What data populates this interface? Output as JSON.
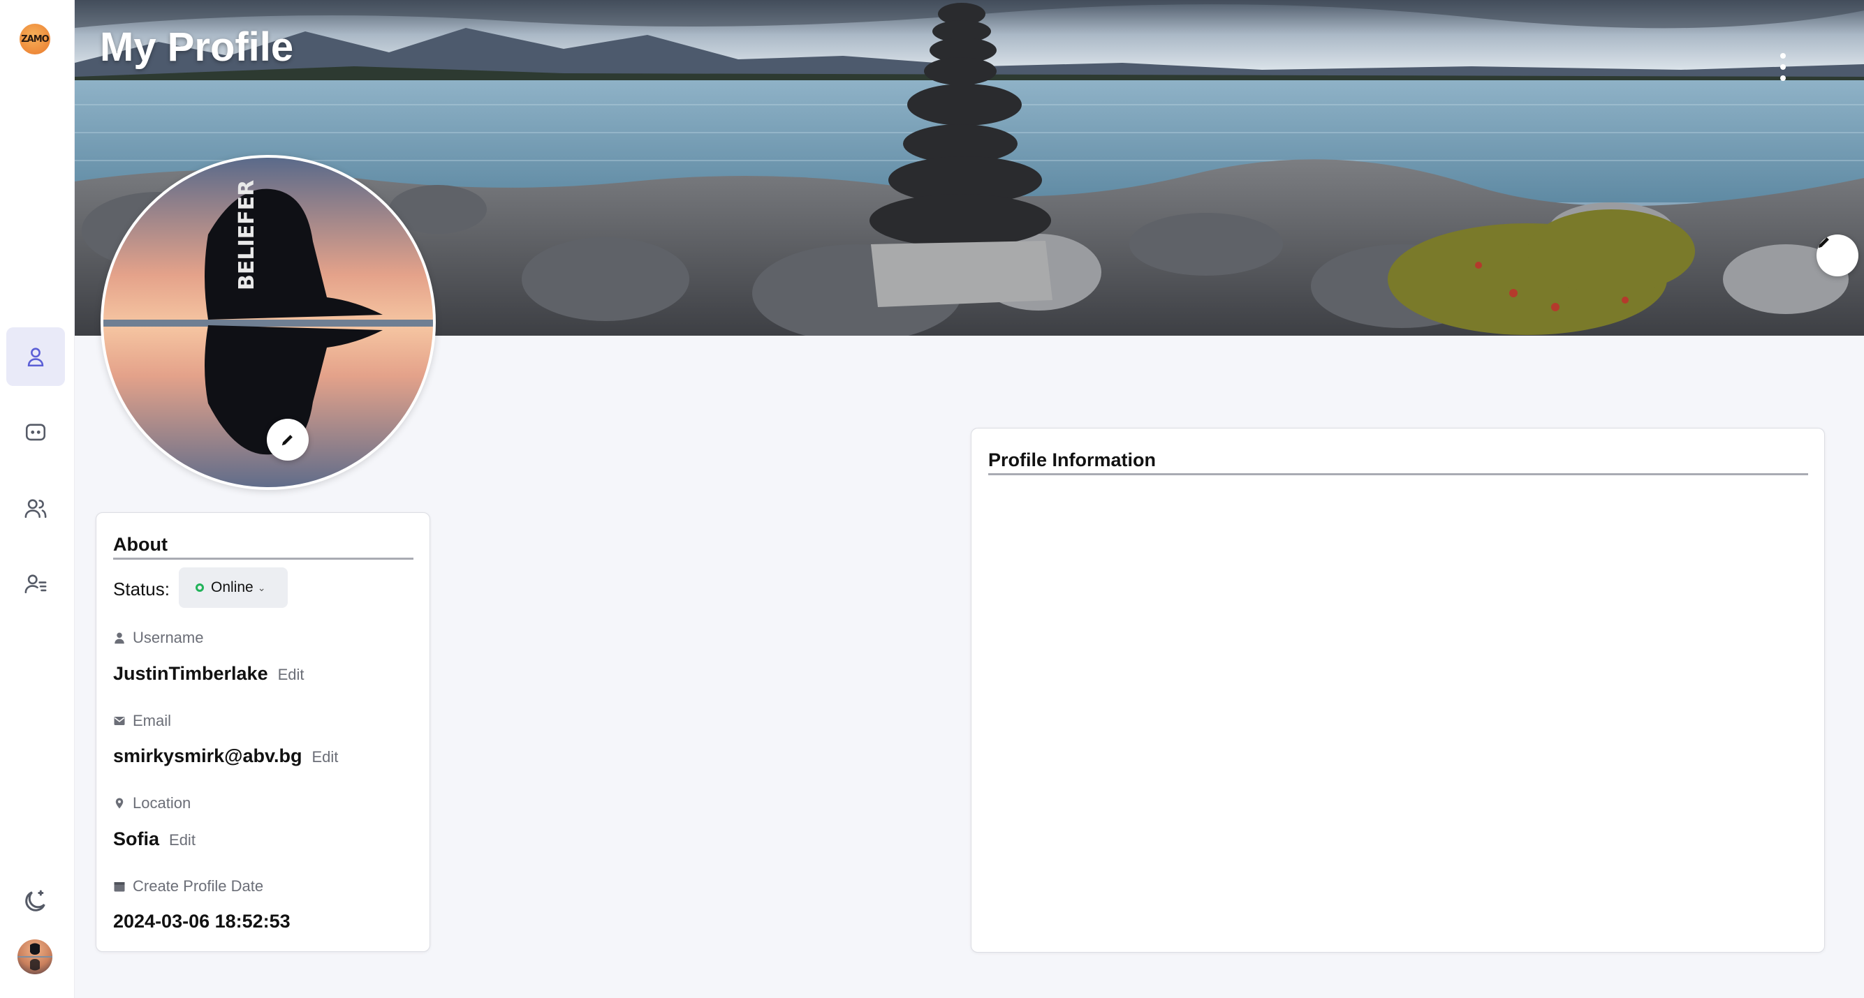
{
  "app": {
    "logo_text": "ZAMO"
  },
  "header": {
    "title": "My Profile"
  },
  "sidebar": {
    "items": [
      {
        "name": "profile",
        "icon": "user-icon",
        "active": true
      },
      {
        "name": "chats",
        "icon": "chat-icon",
        "active": false
      },
      {
        "name": "friends",
        "icon": "users-icon",
        "active": false
      },
      {
        "name": "contacts",
        "icon": "user-list-icon",
        "active": false
      }
    ],
    "bottom": {
      "theme_icon": "moon-icon",
      "avatar": "user-avatar"
    }
  },
  "about": {
    "title": "About",
    "status_label": "Status:",
    "status_value": "Online",
    "username_label": "Username",
    "username_value": "JustinTimberlake",
    "email_label": "Email",
    "email_value": "smirkysmirk@abv.bg",
    "location_label": "Location",
    "location_value": "Sofia",
    "created_label": "Create Profile Date",
    "created_value": "2024-03-06 18:52:53",
    "edit_label": "Edit"
  },
  "profile_info": {
    "title": "Profile Information"
  },
  "colors": {
    "accent": "#5b5fd6",
    "status_online": "#22b35a",
    "background": "#f5f6fa"
  }
}
